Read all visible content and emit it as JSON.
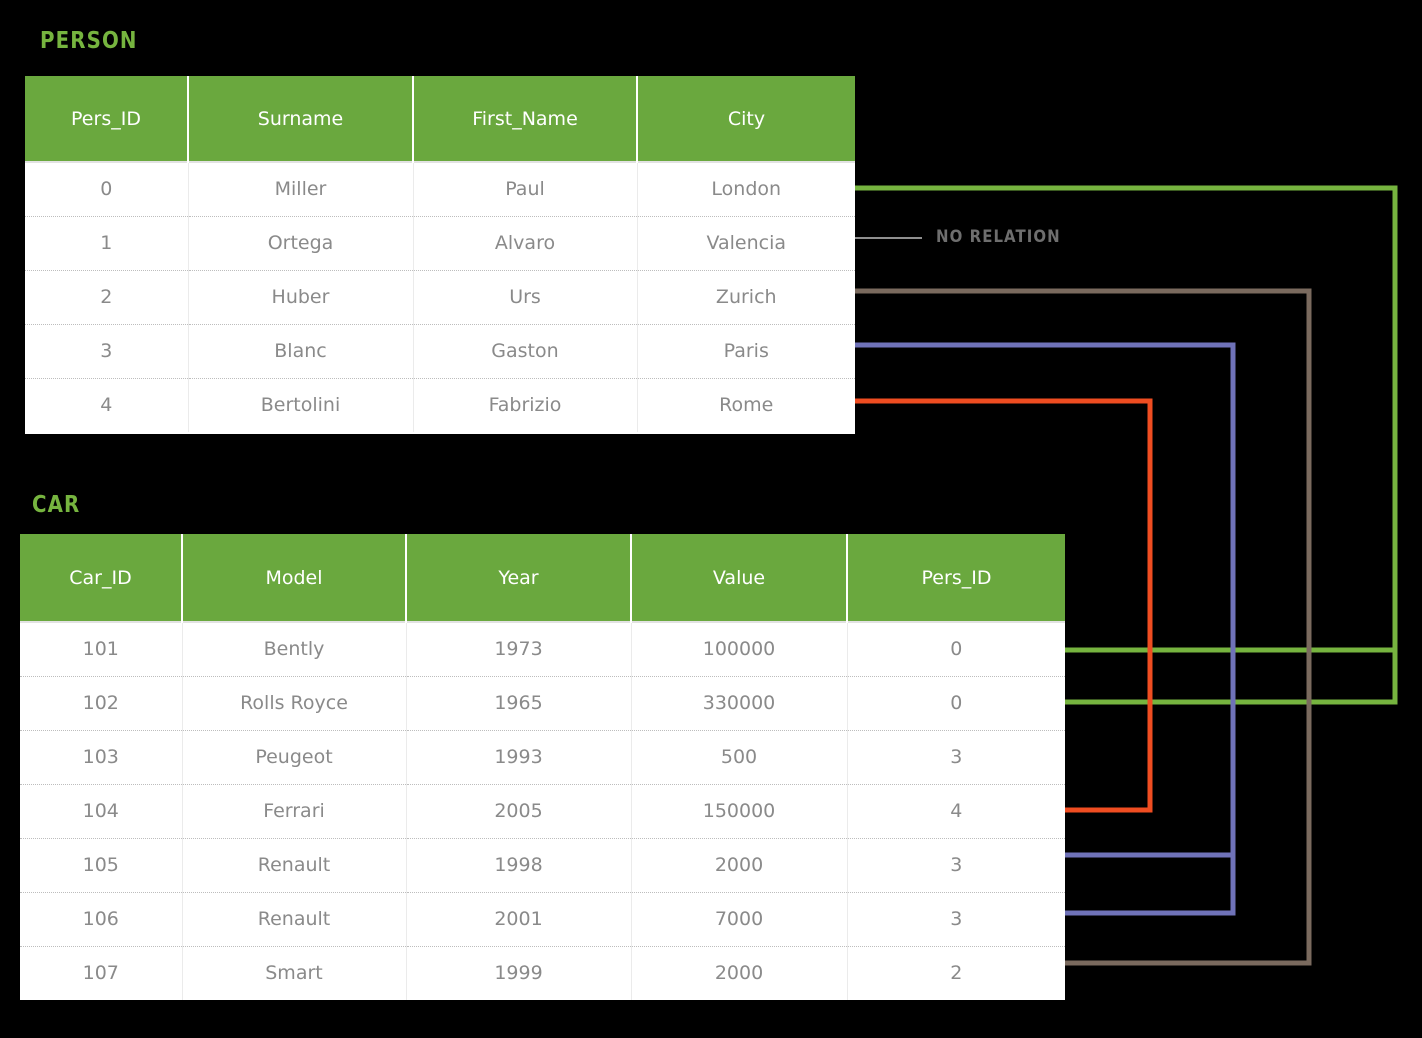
{
  "diagram": {
    "background_color": "#000000",
    "header_color": "#6aa83e",
    "title_color": "#76b43f",
    "cell_text_color": "#8a8a8a"
  },
  "person": {
    "title": "PERSON",
    "columns": [
      "Pers_ID",
      "Surname",
      "First_Name",
      "City"
    ],
    "rows": [
      {
        "pers_id": "0",
        "surname": "Miller",
        "first_name": "Paul",
        "city": "London"
      },
      {
        "pers_id": "1",
        "surname": "Ortega",
        "first_name": "Alvaro",
        "city": "Valencia"
      },
      {
        "pers_id": "2",
        "surname": "Huber",
        "first_name": "Urs",
        "city": "Zurich"
      },
      {
        "pers_id": "3",
        "surname": "Blanc",
        "first_name": "Gaston",
        "city": "Paris"
      },
      {
        "pers_id": "4",
        "surname": "Bertolini",
        "first_name": "Fabrizio",
        "city": "Rome"
      }
    ]
  },
  "car": {
    "title": "CAR",
    "columns": [
      "Car_ID",
      "Model",
      "Year",
      "Value",
      "Pers_ID"
    ],
    "rows": [
      {
        "car_id": "101",
        "model": "Bently",
        "year": "1973",
        "value": "100000",
        "pers_id": "0"
      },
      {
        "car_id": "102",
        "model": "Rolls Royce",
        "year": "1965",
        "value": "330000",
        "pers_id": "0"
      },
      {
        "car_id": "103",
        "model": "Peugeot",
        "year": "1993",
        "value": "500",
        "pers_id": "3"
      },
      {
        "car_id": "104",
        "model": "Ferrari",
        "year": "2005",
        "value": "150000",
        "pers_id": "4"
      },
      {
        "car_id": "105",
        "model": "Renault",
        "year": "1998",
        "value": "2000",
        "pers_id": "3"
      },
      {
        "car_id": "106",
        "model": "Renault",
        "year": "2001",
        "value": "7000",
        "pers_id": "3"
      },
      {
        "car_id": "107",
        "model": "Smart",
        "year": "1999",
        "value": "2000",
        "pers_id": "2"
      }
    ]
  },
  "legend": {
    "no_relation_label": "NO RELATION",
    "no_relation_color": "#8f8f8f"
  },
  "relations": [
    {
      "name": "miller-bently",
      "color": "#76b43f",
      "person_row": "0",
      "car_row": "101"
    },
    {
      "name": "miller-rolls-royce",
      "color": "#76b43f",
      "person_row": "0",
      "car_row": "102"
    },
    {
      "name": "huber-smart",
      "color": "#7a6a5e",
      "person_row": "2",
      "car_row": "107"
    },
    {
      "name": "blanc-renault-105",
      "color": "#6f72b8",
      "person_row": "3",
      "car_row": "105"
    },
    {
      "name": "blanc-renault-106",
      "color": "#6f72b8",
      "person_row": "3",
      "car_row": "106"
    },
    {
      "name": "bertolini-ferrari",
      "color": "#ef4d21",
      "person_row": "4",
      "car_row": "104"
    },
    {
      "name": "ortega-none",
      "color": "#8f8f8f",
      "person_row": "1",
      "car_row": ""
    }
  ]
}
